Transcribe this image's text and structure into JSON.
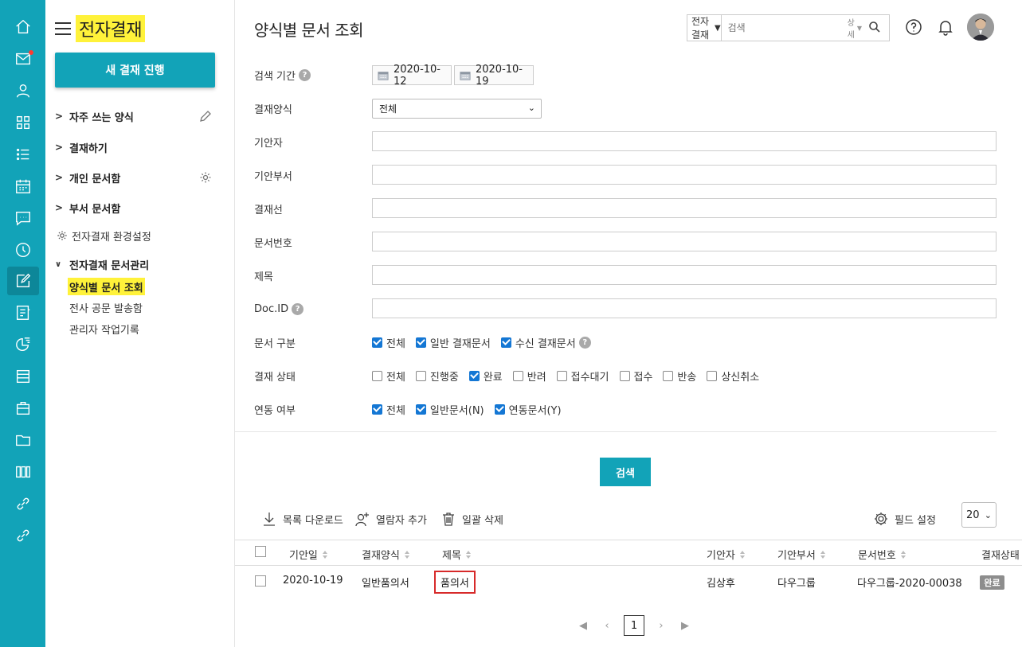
{
  "app": {
    "title": "전자결재"
  },
  "rail": {
    "items": [
      "home-icon",
      "mail-icon",
      "contacts-icon",
      "apps-icon",
      "tasks-icon",
      "calendar-icon",
      "chat-icon",
      "clock-icon",
      "approval-icon",
      "report-icon",
      "survey-icon",
      "board-icon",
      "work-icon",
      "folder-icon",
      "library-icon",
      "link-icon",
      "link2-icon"
    ]
  },
  "sidebar": {
    "new_button": "새 결재 진행",
    "favorites": "자주 쓰는 양식",
    "approve": "결재하기",
    "personal": "개인 문서함",
    "department": "부서 문서함",
    "settings": "전자결재 환경설정",
    "admin": "전자결재 문서관리",
    "admin_items": [
      "양식별 문서 조회",
      "전사 공문 발송함",
      "관리자 작업기록"
    ]
  },
  "header": {
    "page_title": "양식별 문서 조회",
    "search_scope": "전자결재",
    "search_placeholder": "검색",
    "search_detail": "상세"
  },
  "form": {
    "period_label": "검색 기간",
    "date_from": "2020-10-12",
    "date_to": "2020-10-19",
    "form_type_label": "결재양식",
    "form_type_value": "전체",
    "drafter_label": "기안자",
    "draft_dept_label": "기안부서",
    "approval_line_label": "결재선",
    "doc_number_label": "문서번호",
    "subject_label": "제목",
    "docid_label": "Doc.ID",
    "doc_type_label": "문서 구분",
    "doc_type_options": [
      {
        "label": "전체",
        "checked": true
      },
      {
        "label": "일반 결재문서",
        "checked": true
      },
      {
        "label": "수신 결재문서",
        "checked": true
      }
    ],
    "status_label": "결재 상태",
    "status_options": [
      {
        "label": "전체",
        "checked": false
      },
      {
        "label": "진행중",
        "checked": false
      },
      {
        "label": "완료",
        "checked": true
      },
      {
        "label": "반려",
        "checked": false
      },
      {
        "label": "접수대기",
        "checked": false
      },
      {
        "label": "접수",
        "checked": false
      },
      {
        "label": "반송",
        "checked": false
      },
      {
        "label": "상신취소",
        "checked": false
      }
    ],
    "link_label": "연동 여부",
    "link_options": [
      {
        "label": "전체",
        "checked": true
      },
      {
        "label": "일반문서(N)",
        "checked": true
      },
      {
        "label": "연동문서(Y)",
        "checked": true
      }
    ],
    "search_button": "검색"
  },
  "toolbar": {
    "download": "목록 다운로드",
    "add_viewer": "열람자 추가",
    "bulk_delete": "일괄 삭제",
    "field_settings": "필드 설정",
    "page_size": "20"
  },
  "table": {
    "columns": [
      "기안일",
      "결재양식",
      "제목",
      "기안자",
      "기안부서",
      "문서번호",
      "결재상태"
    ],
    "rows": [
      {
        "date": "2020-10-19",
        "form": "일반품의서",
        "title": "품의서",
        "drafter": "김상후",
        "dept": "다우그룹",
        "doc_no": "다우그룹-2020-00038",
        "status": "완료"
      }
    ]
  },
  "pager": {
    "current": "1"
  },
  "colors": {
    "accent": "#12a3b8",
    "highlight": "#fff23a",
    "check": "#1477d4",
    "row_outline": "#d72a2a"
  }
}
